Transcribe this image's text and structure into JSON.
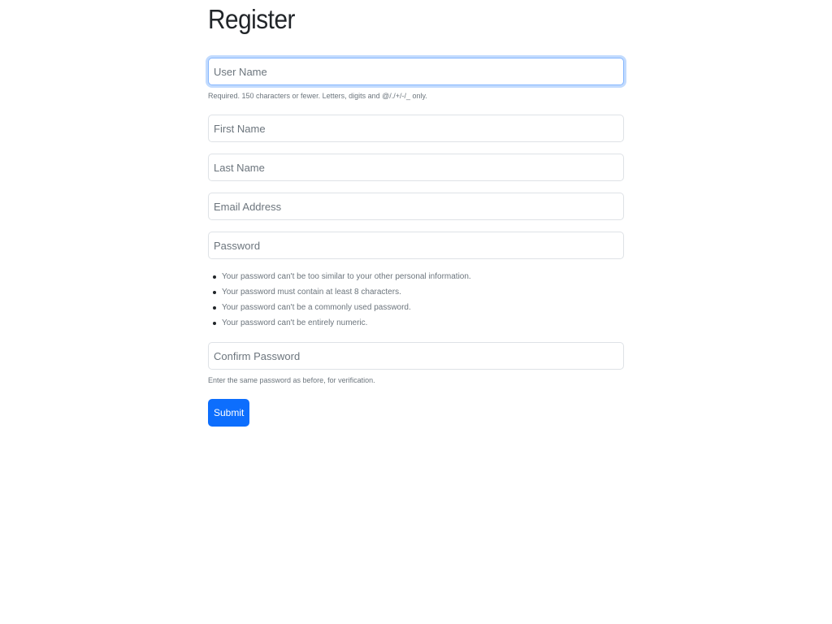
{
  "page": {
    "title": "Register"
  },
  "form": {
    "username": {
      "placeholder": "User Name",
      "value": "",
      "help": "Required. 150 characters or fewer. Letters, digits and @/./+/-/_ only."
    },
    "first_name": {
      "placeholder": "First Name",
      "value": ""
    },
    "last_name": {
      "placeholder": "Last Name",
      "value": ""
    },
    "email": {
      "placeholder": "Email Address",
      "value": ""
    },
    "password": {
      "placeholder": "Password",
      "value": "",
      "rules": [
        "Your password can't be too similar to your other personal information.",
        "Your password must contain at least 8 characters.",
        "Your password can't be a commonly used password.",
        "Your password can't be entirely numeric."
      ]
    },
    "confirm_password": {
      "placeholder": "Confirm Password",
      "value": "",
      "help": "Enter the same password as before, for verification."
    },
    "submit_label": "Submit"
  },
  "colors": {
    "primary": "#0d6efd",
    "focus_border": "#86b7fe",
    "muted_text": "#6c757d",
    "border": "#dee2e6"
  }
}
